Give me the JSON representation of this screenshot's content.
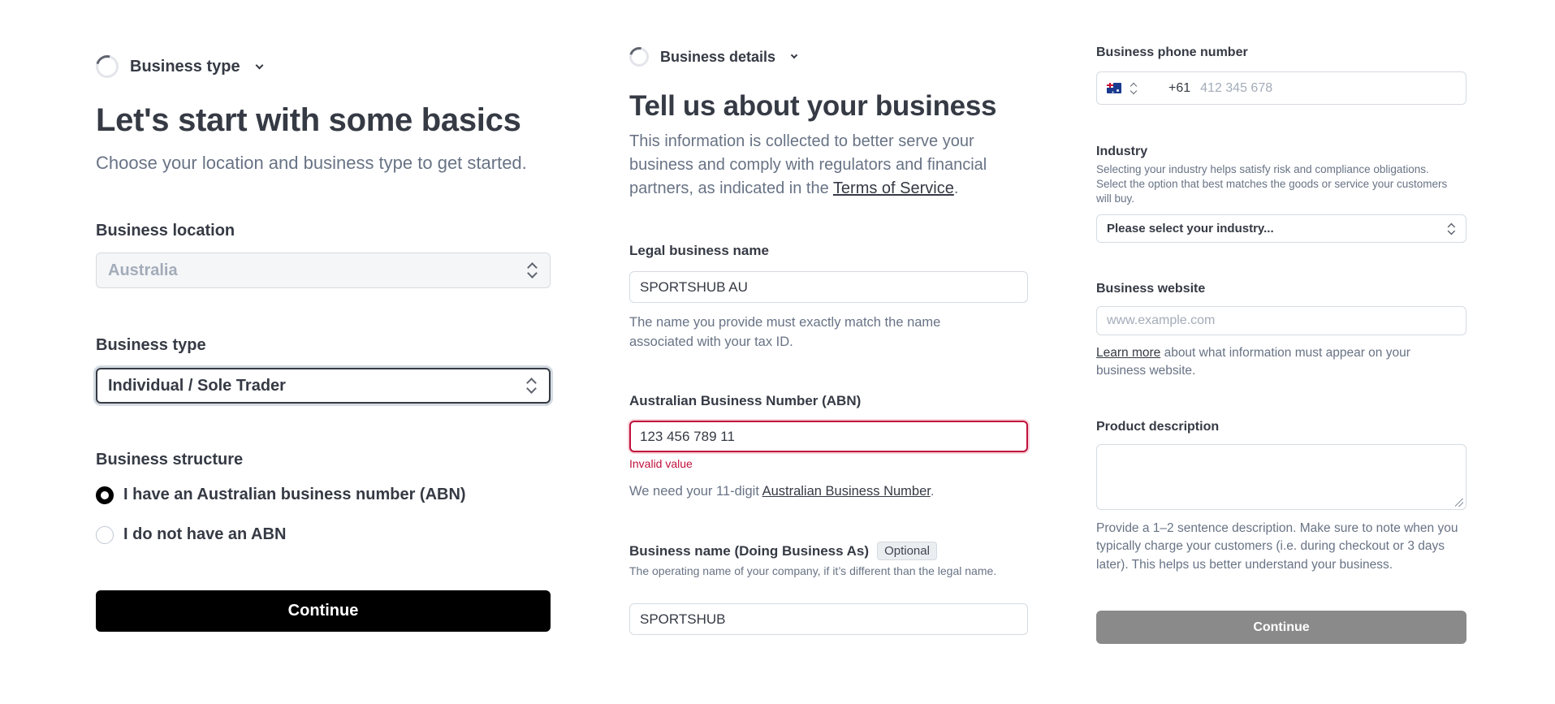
{
  "panel1": {
    "step_label": "Business type",
    "title": "Let's start with some basics",
    "subtitle": "Choose your location and business type to get started.",
    "location": {
      "label": "Business location",
      "value": "Australia"
    },
    "type": {
      "label": "Business type",
      "value": "Individual / Sole Trader"
    },
    "structure": {
      "label": "Business structure",
      "options": [
        {
          "label": "I have an Australian business number (ABN)",
          "selected": true
        },
        {
          "label": "I do not have an ABN",
          "selected": false
        }
      ]
    },
    "continue_label": "Continue"
  },
  "panel2": {
    "step_label": "Business details",
    "title": "Tell us about your business",
    "subtitle_pre": "This information is collected to better serve your business and comply with regulators and financial partners, as indicated in the ",
    "subtitle_link": "Terms of Service",
    "subtitle_post": ".",
    "legal_name": {
      "label": "Legal business name",
      "value": "SPORTSHUB AU",
      "help": "The name you provide must exactly match the name associated with your tax ID."
    },
    "abn": {
      "label": "Australian Business Number (ABN)",
      "value": "123 456 789 11",
      "error": "Invalid value",
      "help_pre": "We need your 11-digit ",
      "help_link": "Australian Business Number",
      "help_post": "."
    },
    "dba": {
      "label": "Business name (Doing Business As)",
      "badge": "Optional",
      "help": "The operating name of your company, if it’s different than the legal name.",
      "value": "SPORTSHUB"
    }
  },
  "panel3": {
    "phone": {
      "label": "Business phone number",
      "prefix": "+61",
      "placeholder": "412 345 678"
    },
    "industry": {
      "label": "Industry",
      "help": "Selecting your industry helps satisfy risk and compliance obligations. Select the option that best matches the goods or service your customers will buy.",
      "value": "Please select your industry..."
    },
    "website": {
      "label": "Business website",
      "placeholder": "www.example.com",
      "help_link": "Learn more",
      "help_post": " about what information must appear on your business website."
    },
    "product": {
      "label": "Product description",
      "value": "",
      "help": "Provide a 1–2 sentence description. Make sure to note when you typically charge your customers (i.e. during checkout or 3 days later). This helps us better understand your business."
    },
    "continue_label": "Continue"
  },
  "colors": {
    "primary_button": "#000000",
    "disabled_button": "#8a8a8a",
    "error": "#c0123c",
    "focus_border": "#353a44"
  }
}
